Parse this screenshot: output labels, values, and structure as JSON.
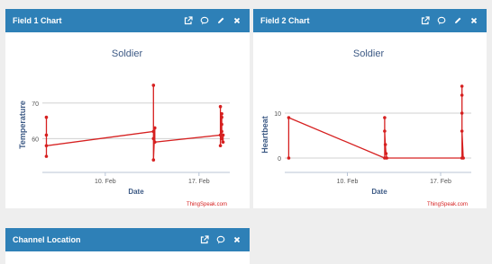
{
  "panels": [
    {
      "title": "Field 1 Chart",
      "chart_data": {
        "type": "line",
        "title": "Soldier",
        "xlabel": "Date",
        "ylabel": "Temperature",
        "credit": "ThingSpeak.com",
        "x_ticks": [
          {
            "label": "10. Feb",
            "day": 10
          },
          {
            "label": "17. Feb",
            "day": 17
          }
        ],
        "y_ticks": [
          60,
          70
        ],
        "xlim": [
          5.3,
          19.3
        ],
        "ylim": [
          52,
          76
        ],
        "series": [
          {
            "color": "#d62020",
            "points": [
              [
                5.6,
                66
              ],
              [
                5.6,
                61
              ],
              [
                5.6,
                55
              ],
              [
                5.6,
                58
              ],
              [
                13.6,
                62
              ],
              [
                13.6,
                75
              ],
              [
                13.6,
                60
              ],
              [
                13.6,
                54
              ],
              [
                13.7,
                63
              ],
              [
                13.7,
                59
              ],
              [
                18.6,
                61
              ],
              [
                18.6,
                69
              ],
              [
                18.6,
                58
              ],
              [
                18.7,
                67
              ],
              [
                18.7,
                66
              ],
              [
                18.7,
                64
              ],
              [
                18.7,
                62
              ],
              [
                18.7,
                60
              ],
              [
                18.8,
                59
              ],
              [
                18.8,
                61
              ]
            ]
          }
        ]
      }
    },
    {
      "title": "Field 2 Chart",
      "chart_data": {
        "type": "line",
        "title": "Soldier",
        "xlabel": "Date",
        "ylabel": "Heartbeat",
        "credit": "ThingSpeak.com",
        "x_ticks": [
          {
            "label": "10. Feb",
            "day": 10
          },
          {
            "label": "17. Feb",
            "day": 17
          }
        ],
        "y_ticks": [
          0,
          10
        ],
        "xlim": [
          5.3,
          19.3
        ],
        "ylim": [
          -2,
          17
        ],
        "series": [
          {
            "color": "#d62020",
            "points": [
              [
                5.6,
                0
              ],
              [
                5.6,
                9
              ],
              [
                12.8,
                0
              ],
              [
                12.8,
                9
              ],
              [
                12.8,
                6
              ],
              [
                12.85,
                3
              ],
              [
                12.9,
                1
              ],
              [
                12.95,
                0
              ],
              [
                18.6,
                0
              ],
              [
                18.6,
                16
              ],
              [
                18.6,
                14
              ],
              [
                18.6,
                10
              ],
              [
                18.6,
                6
              ],
              [
                18.7,
                0
              ]
            ]
          }
        ]
      }
    },
    {
      "title": "Channel Location"
    }
  ]
}
